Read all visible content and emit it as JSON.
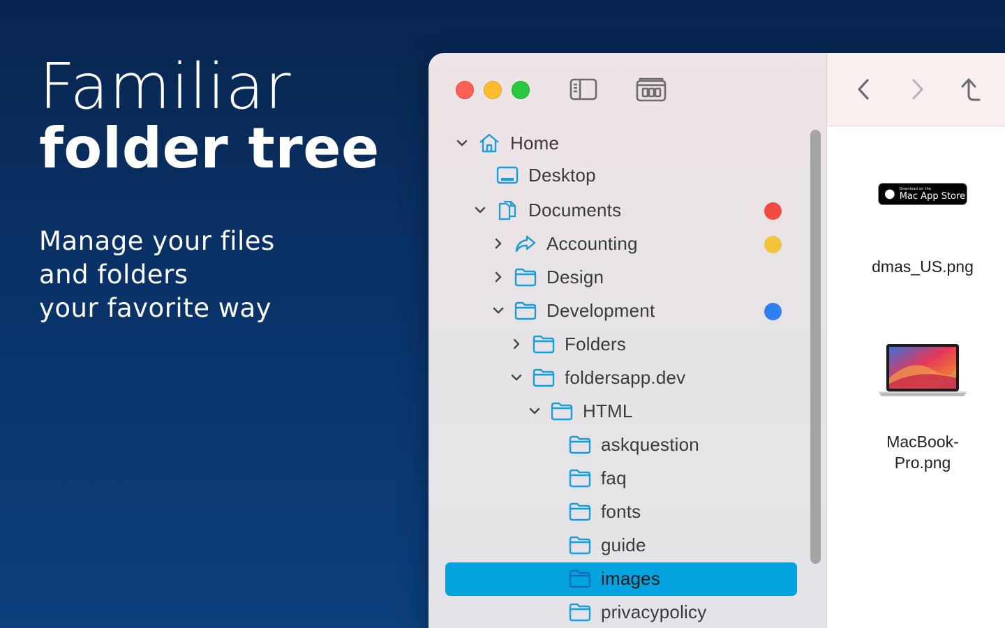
{
  "hero": {
    "line1": "Familiar",
    "line2": "folder tree",
    "subtitle": [
      "Manage your files",
      "and folders",
      "your favorite way"
    ]
  },
  "toolbar": {
    "sidebar_toggle_icon": "sidebar-icon",
    "tabs_icon": "tabs-overview-icon"
  },
  "navigation": {
    "back_icon": "chevron-left-icon",
    "forward_icon": "chevron-right-icon",
    "up_icon": "arrow-up-icon"
  },
  "tree": [
    {
      "label": "Home",
      "depth": 0,
      "expand": "open",
      "icon": "house-icon"
    },
    {
      "label": "Desktop",
      "depth": 1,
      "expand": "none",
      "icon": "desktop-icon"
    },
    {
      "label": "Documents",
      "depth": 1,
      "expand": "open",
      "icon": "documents-icon",
      "tag": "#f24a3f"
    },
    {
      "label": "Accounting",
      "depth": 2,
      "expand": "closed",
      "icon": "shared-folder-icon",
      "tag": "#f2c43a"
    },
    {
      "label": "Design",
      "depth": 2,
      "expand": "closed",
      "icon": "folder-icon"
    },
    {
      "label": "Development",
      "depth": 2,
      "expand": "open",
      "icon": "folder-icon",
      "tag": "#2f7ef0"
    },
    {
      "label": "Folders",
      "depth": 3,
      "expand": "closed",
      "icon": "folder-icon"
    },
    {
      "label": "foldersapp.dev",
      "depth": 3,
      "expand": "open",
      "icon": "folder-icon"
    },
    {
      "label": "HTML",
      "depth": 4,
      "expand": "open",
      "icon": "folder-icon"
    },
    {
      "label": "askquestion",
      "depth": 5,
      "expand": "none",
      "icon": "folder-icon"
    },
    {
      "label": "faq",
      "depth": 5,
      "expand": "none",
      "icon": "folder-icon"
    },
    {
      "label": "fonts",
      "depth": 5,
      "expand": "none",
      "icon": "folder-icon"
    },
    {
      "label": "guide",
      "depth": 5,
      "expand": "none",
      "icon": "folder-icon"
    },
    {
      "label": "images",
      "depth": 5,
      "expand": "none",
      "icon": "folder-icon",
      "selected": true
    },
    {
      "label": "privacypolicy",
      "depth": 5,
      "expand": "none",
      "icon": "folder-icon"
    }
  ],
  "files": [
    {
      "name": "dmas_US.png",
      "thumbnail": "mac-app-store-badge",
      "badge_small": "Download on the",
      "badge_big": "Mac App Store"
    },
    {
      "name_lines": [
        "MacBook-",
        "Pro.png"
      ],
      "thumbnail": "macbook-pro-image"
    }
  ],
  "colors": {
    "selection": "#02a3df",
    "folder_icon": "#1a9cd8",
    "tag_red": "#f24a3f",
    "tag_yellow": "#f2c43a",
    "tag_blue": "#2f7ef0"
  }
}
